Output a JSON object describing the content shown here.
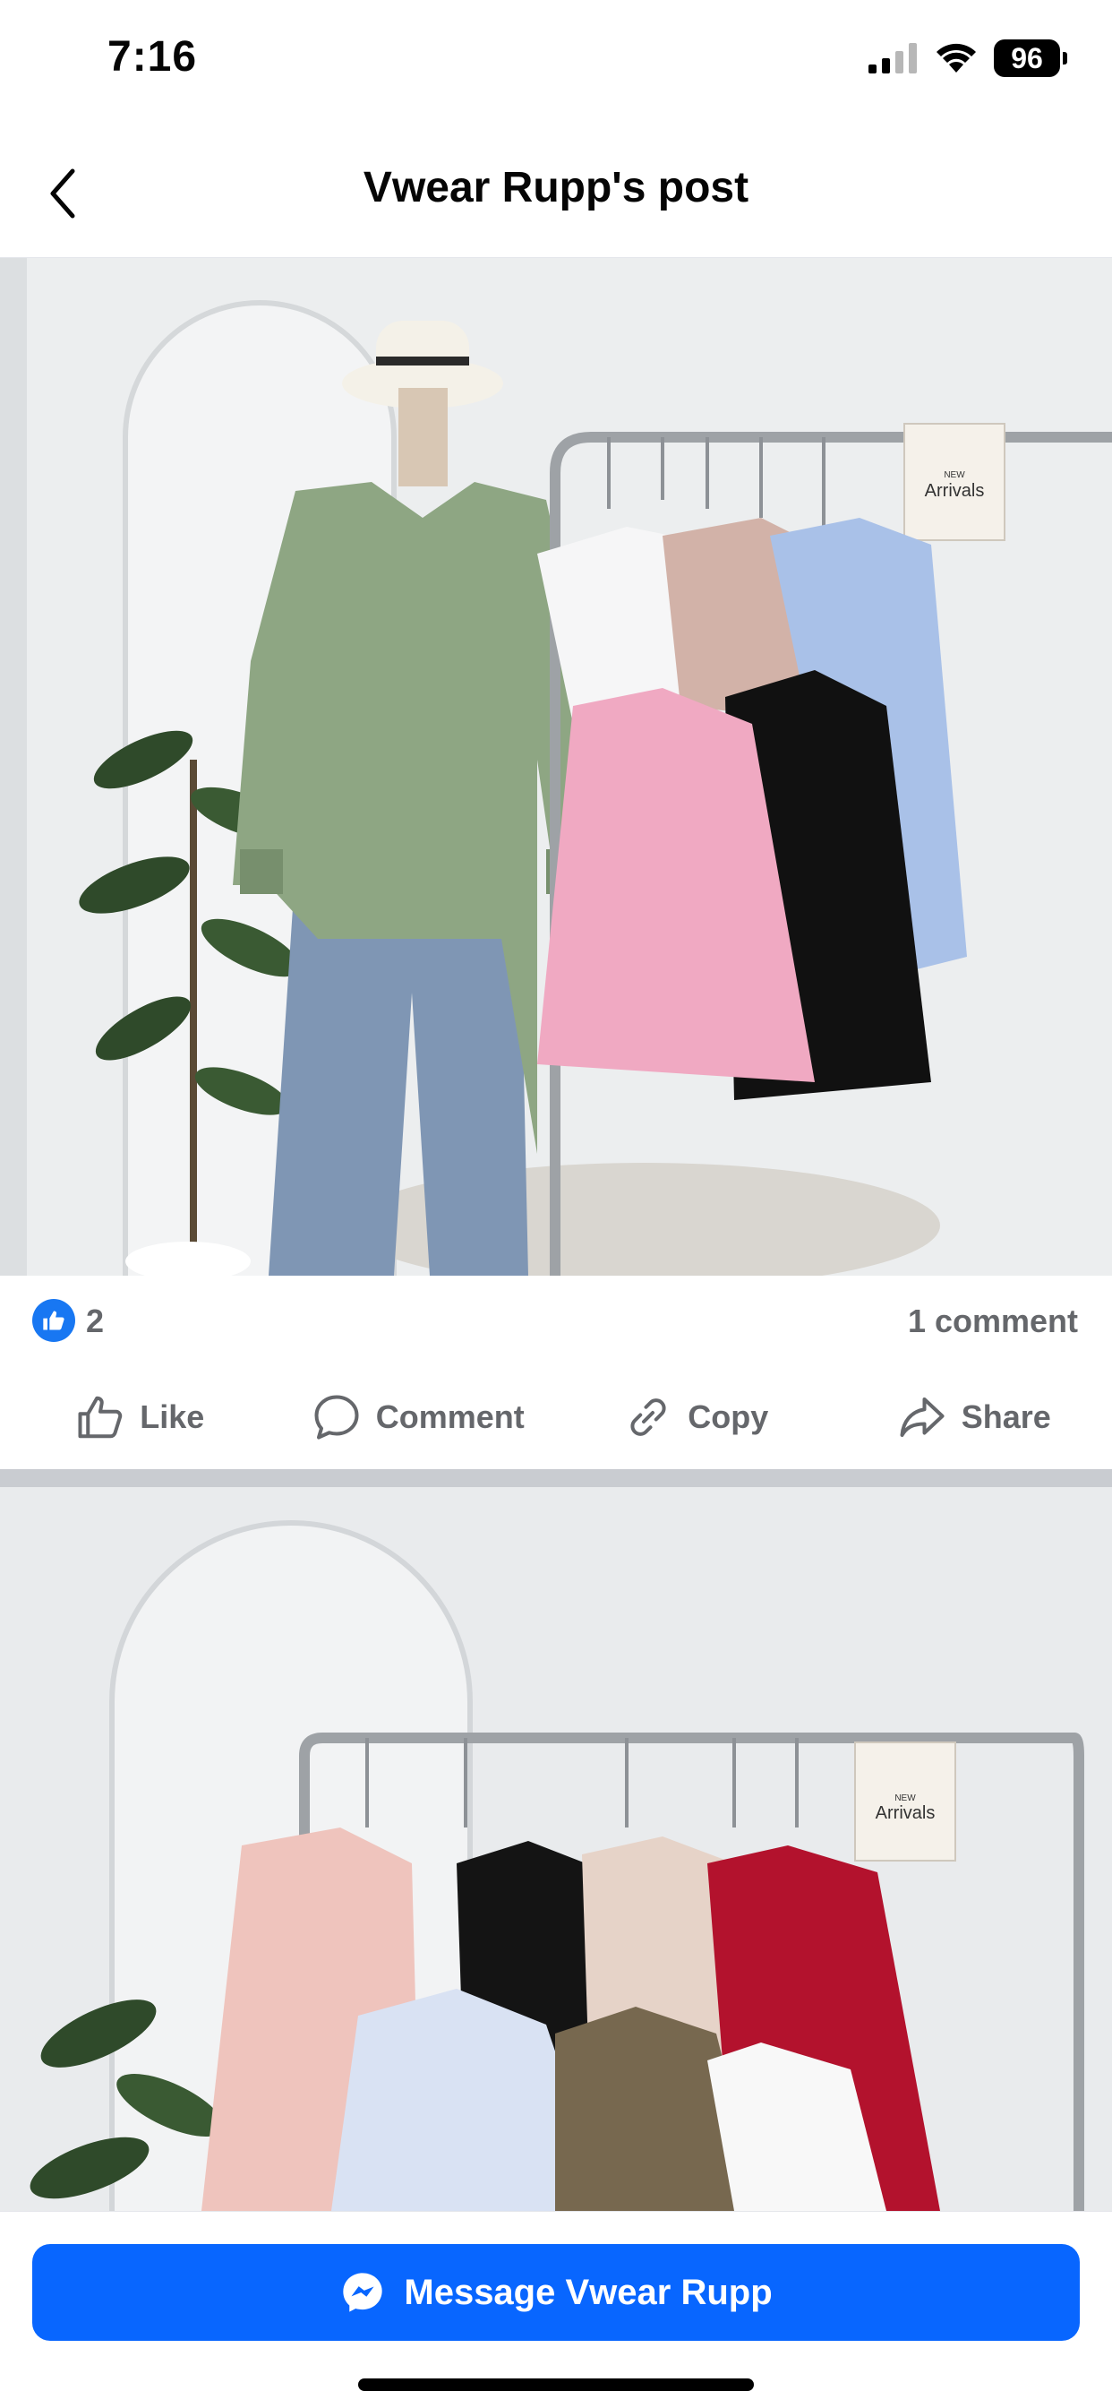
{
  "status_bar": {
    "time": "7:16",
    "battery": "96",
    "icons": [
      "signal-icon",
      "wifi-icon",
      "battery-icon"
    ]
  },
  "header": {
    "title": "Vwear Rupp's post",
    "back_icon": "chevron-left-icon"
  },
  "photos": [
    {
      "sign_small": "NEW",
      "sign_text": "Arrivals"
    },
    {
      "sign_small": "NEW",
      "sign_text": "Arrivals"
    }
  ],
  "reactions": {
    "like_count": "2",
    "comment_count": "1 comment"
  },
  "actions": [
    {
      "label": "Like",
      "icon": "thumbs-up-icon"
    },
    {
      "label": "Comment",
      "icon": "comment-icon"
    },
    {
      "label": "Copy",
      "icon": "link-icon"
    },
    {
      "label": "Share",
      "icon": "share-icon"
    }
  ],
  "message_button": {
    "label": "Message Vwear Rupp",
    "icon": "messenger-icon"
  },
  "colors": {
    "accent": "#0866ff",
    "like_blue": "#1877f2",
    "muted_text": "#65676b"
  }
}
